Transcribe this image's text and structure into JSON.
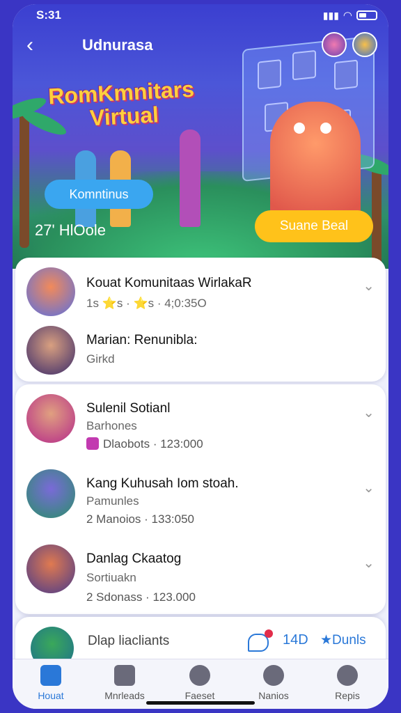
{
  "status": {
    "time": "S:31"
  },
  "header": {
    "title": "Udnurasa"
  },
  "hero": {
    "title_line1": "RomKmnitars",
    "title_line2": "Virtual",
    "left_button": "Komntinus",
    "count": "27' HlOole",
    "right_button": "Suane Beal"
  },
  "section1": [
    {
      "name": "Kouat Komunitaas WirlakaR",
      "sub": "1s ⭐s · ⭐s · 4;0:35O"
    },
    {
      "name": "Marian: Renunibla:",
      "sub": "Girkd"
    }
  ],
  "section2": [
    {
      "name": "Sulenil Sotianl",
      "sub": "Barhones",
      "sub2": "Dlaobots · 123:000"
    },
    {
      "name": "Kang Kuhusah Iom stoah.",
      "sub": "Pamunles",
      "sub2": "2 Manoios · 133:050"
    },
    {
      "name": "Danlag Ckaatog",
      "sub": "Sortiuakn",
      "sub2": "2 Sdonass · 123.000"
    }
  ],
  "bottom_item": {
    "label": "Dlap liacliants",
    "number": "14D",
    "link": "Dunls"
  },
  "tabs": [
    {
      "label": "Houat"
    },
    {
      "label": "Mnrleads"
    },
    {
      "label": "Faeset"
    },
    {
      "label": "Nanios"
    },
    {
      "label": "Repis"
    }
  ]
}
